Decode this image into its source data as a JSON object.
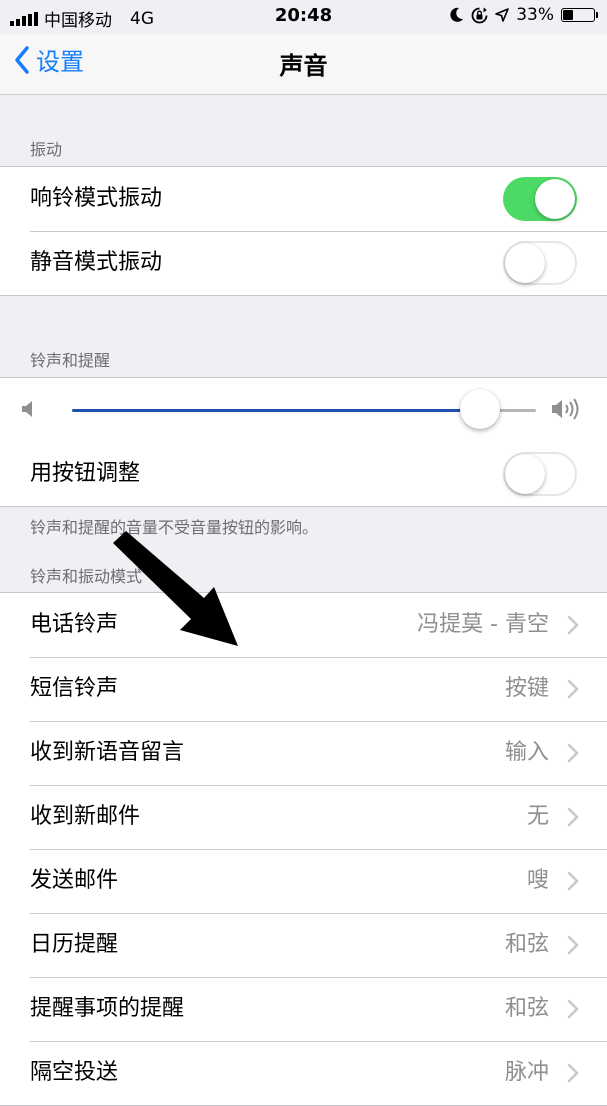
{
  "status_bar": {
    "carrier": "中国移动",
    "network": "4G",
    "time": "20:48",
    "battery_percent": "33%",
    "battery_level": 0.33
  },
  "nav": {
    "back_label": "设置",
    "title": "声音",
    "accent_color": "#157efb"
  },
  "vibration_section": {
    "header": "振动",
    "rows": [
      {
        "label": "响铃模式振动",
        "toggle_on": true
      },
      {
        "label": "静音模式振动",
        "toggle_on": false
      }
    ]
  },
  "ringer_section": {
    "header": "铃声和提醒",
    "volume_level": 0.88,
    "adjust_with_buttons": {
      "label": "用按钮调整",
      "toggle_on": false
    },
    "footer": "铃声和提醒的音量不受音量按钮的影响。"
  },
  "patterns_section": {
    "header": "铃声和振动模式",
    "rows": [
      {
        "label": "电话铃声",
        "value": "冯提莫 - 青空"
      },
      {
        "label": "短信铃声",
        "value": "按键"
      },
      {
        "label": "收到新语音留言",
        "value": "输入"
      },
      {
        "label": "收到新邮件",
        "value": "无"
      },
      {
        "label": "发送邮件",
        "value": "嗖"
      },
      {
        "label": "日历提醒",
        "value": "和弦"
      },
      {
        "label": "提醒事项的提醒",
        "value": "和弦"
      },
      {
        "label": "隔空投送",
        "value": "脉冲"
      }
    ]
  },
  "icons": {
    "signal": "cellular-signal-icon",
    "moon": "do-not-disturb-moon-icon",
    "rotation_lock": "rotation-lock-icon",
    "location": "location-arrow-icon",
    "battery": "battery-icon",
    "back": "chevron-left-icon",
    "disclosure": "chevron-right-icon",
    "volume_low": "speaker-low-icon",
    "volume_high": "speaker-high-icon"
  }
}
